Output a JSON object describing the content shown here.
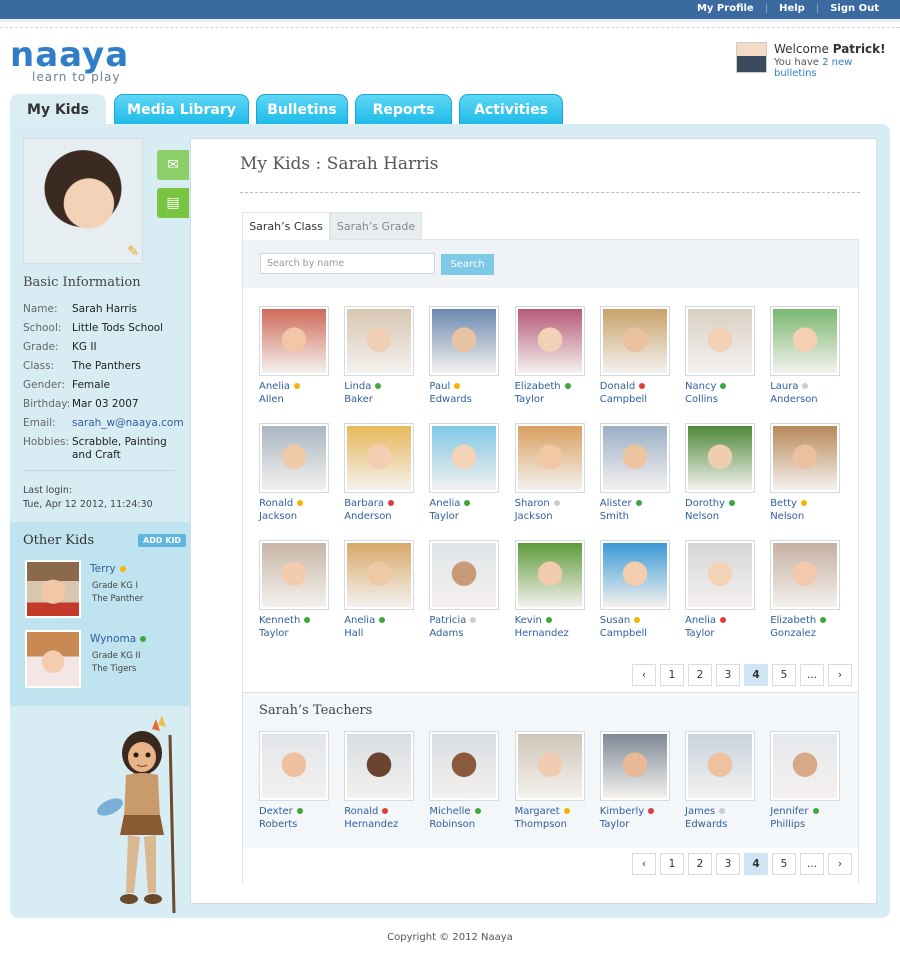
{
  "topbar": {
    "links": [
      "My Profile",
      "Help",
      "Sign Out"
    ]
  },
  "logo": {
    "word": "naaya",
    "tagline": "learn to play"
  },
  "welcome": {
    "greeting": "Welcome",
    "user": "Patrick!",
    "prefix": "You have",
    "bulletins": "2 new bulletins"
  },
  "tabs": [
    "My Kids",
    "Media Library",
    "Bulletins",
    "Reports",
    "Activities"
  ],
  "basic_info": {
    "title": "Basic Information",
    "fields": [
      {
        "k": "Name:",
        "v": "Sarah Harris"
      },
      {
        "k": "School:",
        "v": "Little Tods School"
      },
      {
        "k": "Grade:",
        "v": "KG II"
      },
      {
        "k": "Class:",
        "v": "The Panthers"
      },
      {
        "k": "Gender:",
        "v": "Female"
      },
      {
        "k": "Birthday:",
        "v": "Mar 03 2007"
      },
      {
        "k": "Email:",
        "v": "sarah_w@naaya.com"
      },
      {
        "k": "Hobbies:",
        "v": "Scrabble, Painting and Craft"
      }
    ],
    "last_login_label": "Last login:",
    "last_login": "Tue, Apr 12 2012, 11:24:30"
  },
  "other_kids": {
    "title": "Other Kids",
    "add_label": "ADD KID",
    "kids": [
      {
        "name": "Terry",
        "grade": "Grade KG I",
        "class": "The Panther",
        "status": "#f5b400"
      },
      {
        "name": "Wynoma",
        "grade": "Grade KG II",
        "class": "The Tigers",
        "status": "#3aa83a"
      }
    ]
  },
  "main": {
    "title": "My Kids : Sarah  Harris",
    "tabs": [
      "Sarah’s Class",
      "Sarah’s Grade"
    ],
    "search_placeholder": "Search by name",
    "search_button": "Search",
    "classmates": [
      {
        "f": "Anelia",
        "l": "Allen",
        "s": "#f5b400"
      },
      {
        "f": "Linda",
        "l": "Baker",
        "s": "#3aa83a"
      },
      {
        "f": "Paul",
        "l": "Edwards",
        "s": "#f5b400"
      },
      {
        "f": "Elizabeth",
        "l": "Taylor",
        "s": "#3aa83a"
      },
      {
        "f": "Donald",
        "l": "Campbell",
        "s": "#e33b3b"
      },
      {
        "f": "Nancy",
        "l": "Collins",
        "s": "#3aa83a"
      },
      {
        "f": "Laura",
        "l": "Anderson",
        "s": "#cccccc"
      },
      {
        "f": "Ronald",
        "l": "Jackson",
        "s": "#f5b400"
      },
      {
        "f": "Barbara",
        "l": "Anderson",
        "s": "#e33b3b"
      },
      {
        "f": "Anelia",
        "l": "Taylor",
        "s": "#3aa83a"
      },
      {
        "f": "Sharon",
        "l": "Jackson",
        "s": "#cccccc"
      },
      {
        "f": "Alister",
        "l": "Smith",
        "s": "#3aa83a"
      },
      {
        "f": "Dorothy",
        "l": "Nelson",
        "s": "#3aa83a"
      },
      {
        "f": "Betty",
        "l": "Nelson",
        "s": "#f5b400"
      },
      {
        "f": "Kenneth",
        "l": "Taylor",
        "s": "#3aa83a"
      },
      {
        "f": "Anelia",
        "l": "Hall",
        "s": "#3aa83a"
      },
      {
        "f": "Patricia",
        "l": "Adams",
        "s": "#cccccc"
      },
      {
        "f": "Kevin",
        "l": "Hernandez",
        "s": "#3aa83a"
      },
      {
        "f": "Susan",
        "l": "Campbell",
        "s": "#f5b400"
      },
      {
        "f": "Anelia",
        "l": "Taylor",
        "s": "#e33b3b"
      },
      {
        "f": "Elizabeth",
        "l": "Gonzalez",
        "s": "#3aa83a"
      }
    ],
    "pager": [
      "‹",
      "1",
      "2",
      "3",
      "4",
      "5",
      "...",
      "›"
    ],
    "pager_current": "4",
    "teachers_title": "Sarah’s Teachers",
    "teachers": [
      {
        "f": "Dexter",
        "l": "Roberts",
        "s": "#3aa83a"
      },
      {
        "f": "Ronald",
        "l": "Hernandez",
        "s": "#e33b3b"
      },
      {
        "f": "Michelle",
        "l": "Robinson",
        "s": "#3aa83a"
      },
      {
        "f": "Margaret",
        "l": "Thompson",
        "s": "#f5b400"
      },
      {
        "f": "Kimberly",
        "l": "Taylor",
        "s": "#e33b3b"
      },
      {
        "f": "James",
        "l": "Edwards",
        "s": "#cccccc"
      },
      {
        "f": "Jennifer",
        "l": "Phillips",
        "s": "#3aa83a"
      }
    ]
  },
  "footer": {
    "copyright": "Copyright © 2012 Naaya"
  }
}
